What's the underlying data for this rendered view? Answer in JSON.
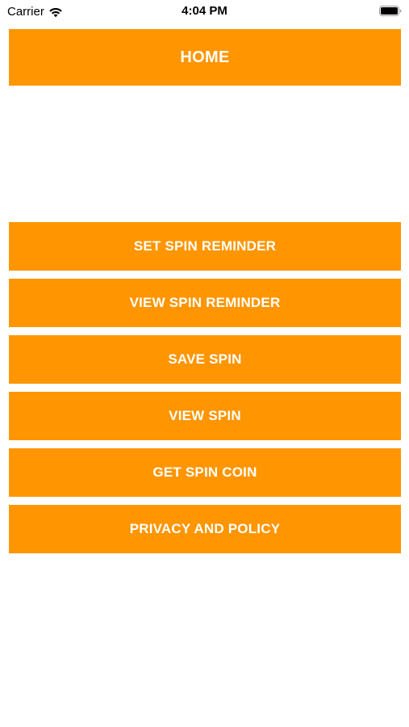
{
  "status_bar": {
    "carrier": "Carrier",
    "time": "4:04 PM",
    "icons": [
      "wifi-icon",
      "battery-icon"
    ]
  },
  "header": {
    "title": "HOME"
  },
  "menu": {
    "items": [
      {
        "label": "SET SPIN REMINDER"
      },
      {
        "label": "VIEW SPIN REMINDER"
      },
      {
        "label": "SAVE SPIN"
      },
      {
        "label": "VIEW SPIN"
      },
      {
        "label": "GET SPIN COIN"
      },
      {
        "label": "PRIVACY AND POLICY"
      }
    ]
  },
  "colors": {
    "accent": "#FF9500",
    "button_text": "#FFFFFF",
    "background": "#FFFFFF"
  }
}
